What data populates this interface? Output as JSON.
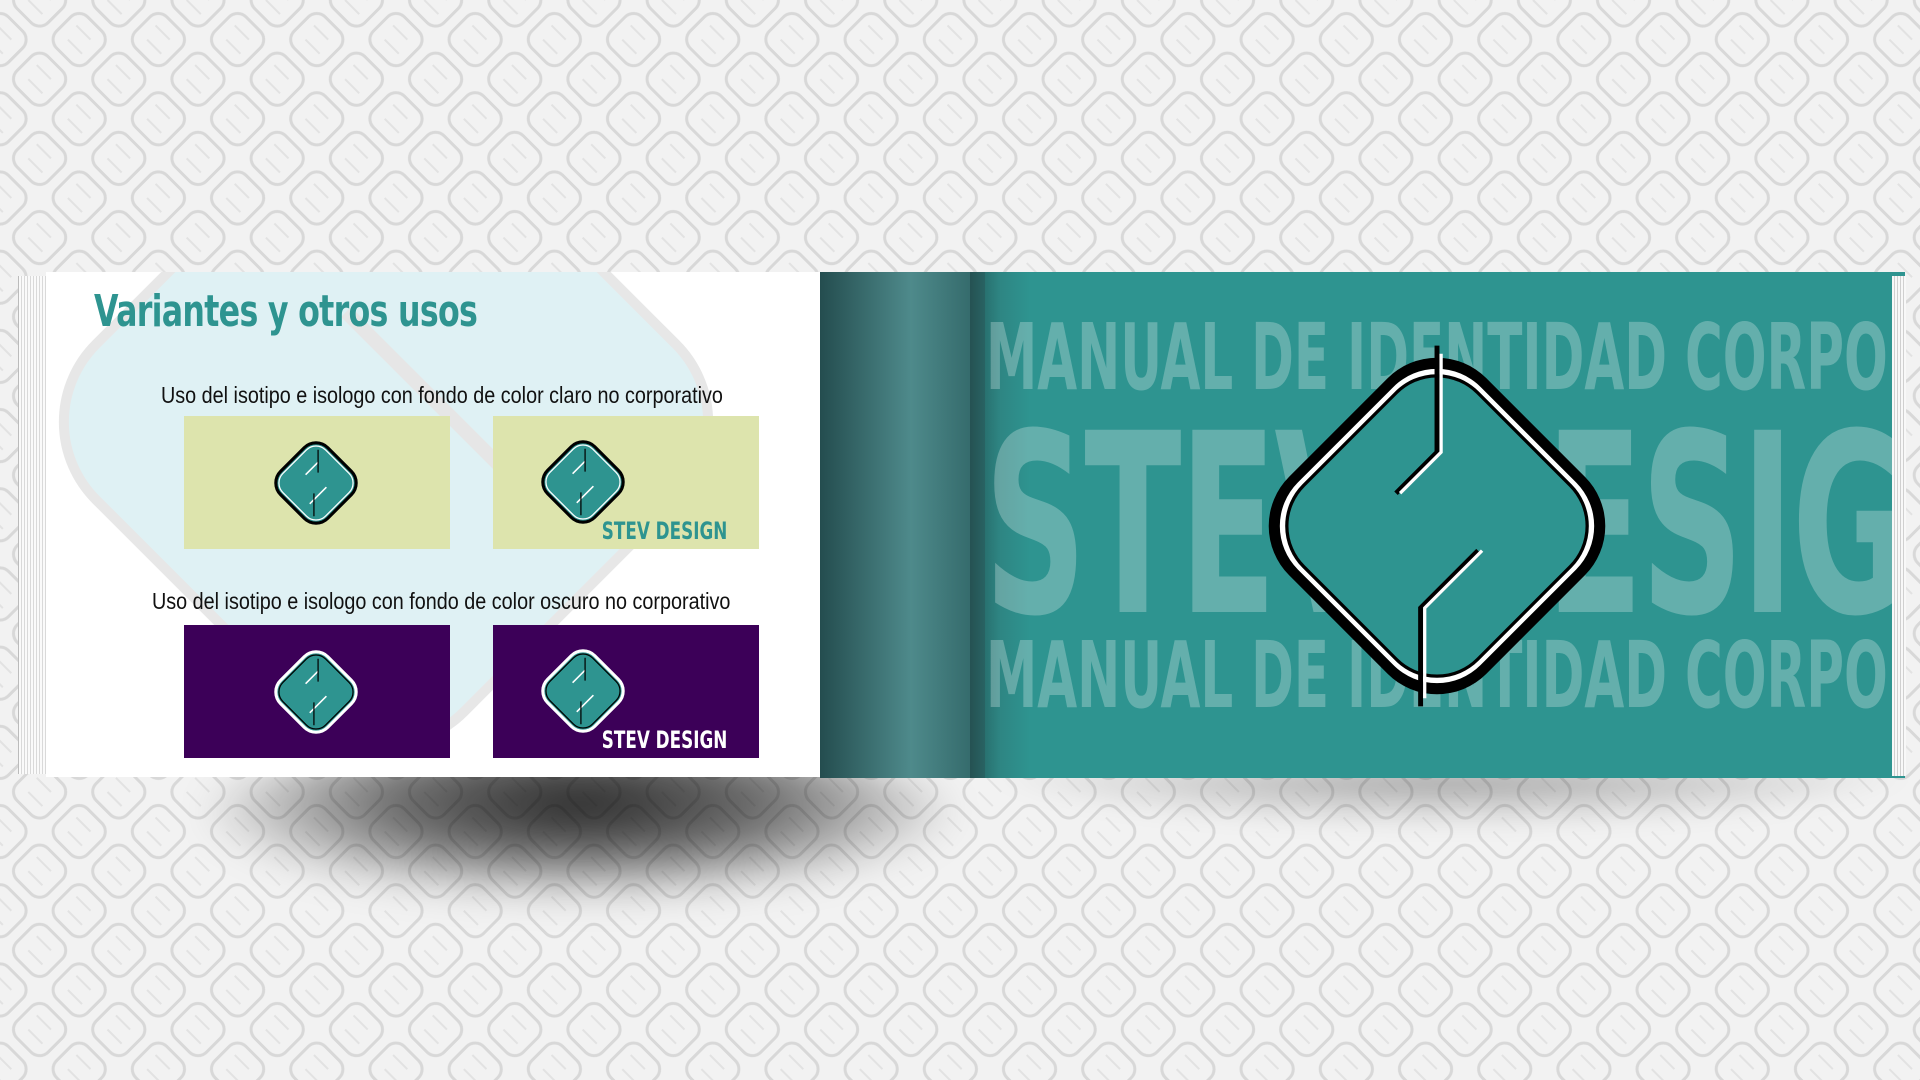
{
  "left_page": {
    "title": "Variantes y otros usos",
    "caption_light": "Uso del isotipo e isologo con fondo de color claro no corporativo",
    "caption_dark": "Uso del isotipo e isologo con fondo de color oscuro no corporativo",
    "wordmark_light": "STEV DESIGN",
    "wordmark_dark": "STEV DESIGN"
  },
  "right_page": {
    "line_top": "MANUAL DE IDENTIDAD CORPORATIVA",
    "line_middle": "STEV DESIGN",
    "line_bottom": "MANUAL DE IDENTIDAD CORPORATIVA"
  },
  "icons": [
    "stev-design-logo-icon",
    "diamond-pattern-icon"
  ],
  "colors": {
    "brand_teal": "#2e9490",
    "light_background": "#dde4ad",
    "dark_background": "#3c0058",
    "wordmark_on_light": "#2e9490",
    "wordmark_on_dark": "#ffffff"
  }
}
